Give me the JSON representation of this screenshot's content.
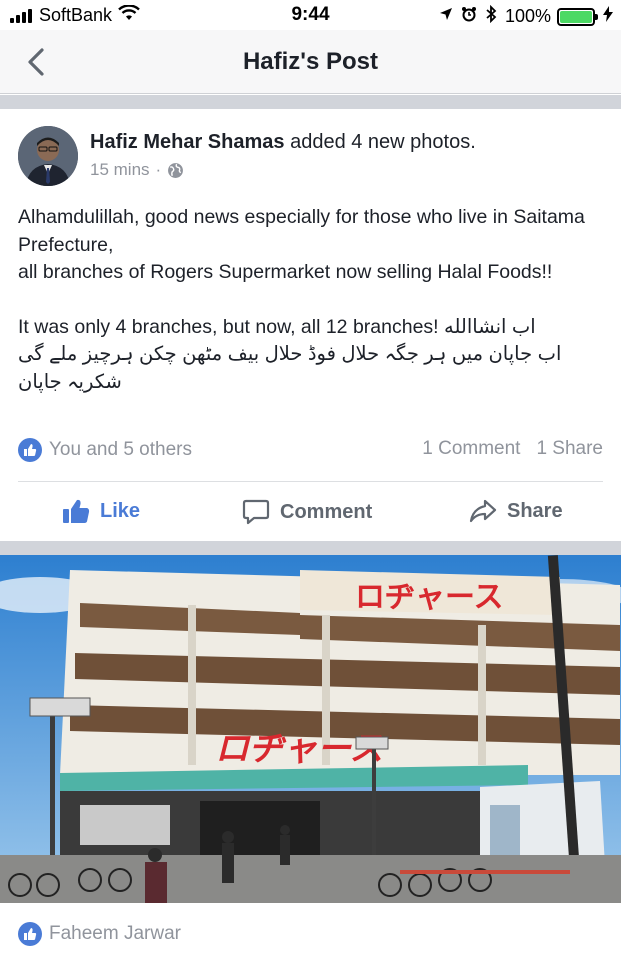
{
  "status_bar": {
    "carrier": "SoftBank",
    "time": "9:44",
    "battery_percent": "100%",
    "battery_level": 1.0,
    "icons": [
      "signal-icon",
      "wifi-icon",
      "location-icon",
      "alarm-icon",
      "bluetooth-icon",
      "battery-icon",
      "charging-icon"
    ]
  },
  "nav": {
    "title": "Hafiz's Post"
  },
  "post": {
    "author": "Hafiz Mehar Shamas",
    "action_text": "added 4 new photos.",
    "time_ago": "15 mins",
    "meta_separator": "·",
    "privacy_icon": "globe-icon",
    "text_lines": [
      "Alhamdulillah, good news especially for those who live in Saitama Prefecture,",
      "all branches of Rogers Supermarket now selling Halal Foods!!"
    ],
    "text_line_2": "It was only 4 branches, but now, all 12 branches! ",
    "urdu_inline": "اب انشاالله",
    "urdu_line_1": "اب جاپان میں ہر جگہ حلال فوڈ  حلال بیف مٹھن چکن ہرچیز  ملے گی",
    "urdu_line_2": "شکریہ جاپان",
    "reactions_summary": "You and 5 others",
    "comments_count": "1 Comment",
    "shares_count": "1 Share",
    "accent_color": "#4a7bd6"
  },
  "actions": {
    "like": "Like",
    "comment": "Comment",
    "share": "Share"
  },
  "photo": {
    "sign_text": "ロヂャース"
  },
  "next_post": {
    "name": "Faheem Jarwar"
  }
}
